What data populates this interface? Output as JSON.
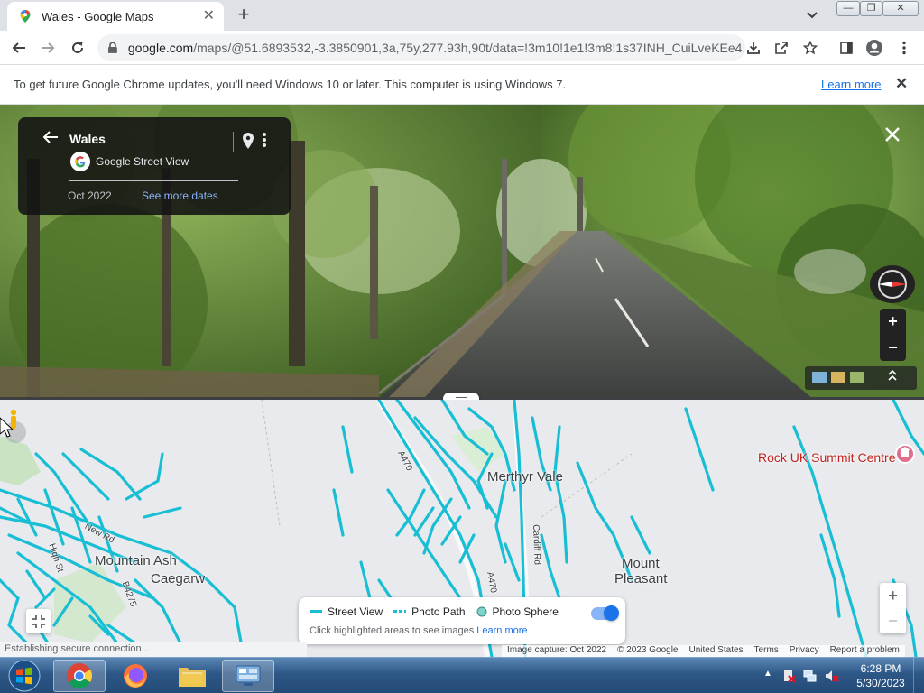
{
  "browser": {
    "tab_title": "Wales - Google Maps",
    "new_tab": "+",
    "url_host": "google.com",
    "url_path": "/maps/@51.6893532,-3.3850901,3a,75y,277.93h,90t/data=!3m10!1e1!3m8!1s37INH_CuiLveKEe4...",
    "win_min": "—",
    "win_max": "❐",
    "win_close": "✕"
  },
  "infobar": {
    "message": "To get future Google Chrome updates, you'll need Windows 10 or later. This computer is using Windows 7.",
    "learn_more": "Learn more",
    "close": "✕"
  },
  "streetview": {
    "title": "Wales",
    "provider": "Google Street View",
    "date": "Oct 2022",
    "see_more_dates": "See more dates",
    "zoom_in": "+",
    "zoom_out": "−",
    "icons": [
      "back-arrow-icon",
      "location-pin-icon",
      "more-vert-icon",
      "close-icon",
      "compass-icon",
      "expand-up-icon"
    ]
  },
  "map": {
    "places": {
      "merthyr_vale": "Merthyr Vale",
      "mountain_ash": "Mountain Ash",
      "caegarw": "Caegarw",
      "mount": "Mount",
      "pleasant": "Pleasant",
      "rock_uk": "Rock UK Summit Centre"
    },
    "roads": {
      "a4701": "A470",
      "a4702": "A470",
      "cardiff_rd": "Cardiff Rd",
      "new_rd": "New Rd",
      "high_st": "High St",
      "b4275": "B4275"
    },
    "legend": {
      "street_view": "Street View",
      "photo_path": "Photo Path",
      "photo_sphere": "Photo Sphere",
      "hint": "Click highlighted areas to see images",
      "learn_more": "Learn more",
      "toggle_on": true
    },
    "zoom_in": "+",
    "zoom_out": "−",
    "attribution": {
      "capture": "Image capture: Oct 2022",
      "copyright": "© 2023 Google",
      "region": "United States",
      "terms": "Terms",
      "privacy": "Privacy",
      "report": "Report a problem"
    },
    "status": "Establishing secure connection...",
    "colors": {
      "coverage": "#17bed4",
      "map_bg": "#e8eaed",
      "poi_pink": "#e06e8c"
    }
  },
  "taskbar": {
    "time": "6:28 PM",
    "date": "5/30/2023",
    "apps": [
      "chrome-icon",
      "firefox-icon",
      "file-explorer-icon",
      "control-panel-icon"
    ]
  }
}
